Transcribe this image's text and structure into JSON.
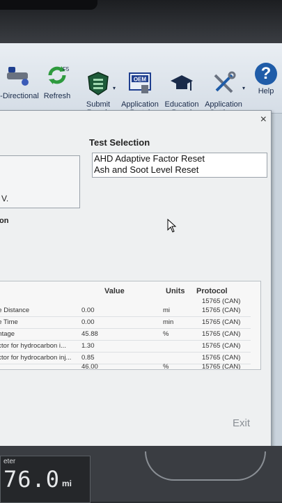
{
  "toolbar": {
    "items": [
      {
        "label": "-Directional",
        "icon": "directional-icon"
      },
      {
        "label": "Refresh",
        "key": "F5",
        "icon": "refresh-icon"
      },
      {
        "label": "Submit\nRepair",
        "icon": "submit-repair-icon"
      },
      {
        "label": "Application\nPortal",
        "icon": "oem-portal-icon",
        "badge": "OEM"
      },
      {
        "label": "Education\nPortal",
        "icon": "graduation-cap-icon"
      },
      {
        "label": "Application\nSettings",
        "icon": "tools-icon"
      },
      {
        "label": "Help",
        "icon": "help-icon",
        "glyph": "?"
      }
    ]
  },
  "dialog": {
    "close": "×",
    "left_panel_text": "V.",
    "section_label": "on",
    "test_selection": {
      "title": "Test Selection",
      "options": [
        "AHD Adaptive Factor Reset",
        "Ash and Soot Level Reset"
      ]
    },
    "grid": {
      "headers": {
        "value": "Value",
        "units": "Units",
        "protocol": "Protocol"
      },
      "rows": [
        {
          "name": "",
          "value": "",
          "unit": "",
          "protocol": "15765 (CAN)"
        },
        {
          "name": "ge Distance",
          "value": "0.00",
          "unit": "mi",
          "protocol": "15765 (CAN)"
        },
        {
          "name": "ge Time",
          "value": "0.00",
          "unit": "min",
          "protocol": "15765 (CAN)"
        },
        {
          "name": "entage",
          "value": "45.88",
          "unit": "%",
          "protocol": "15765 (CAN)"
        },
        {
          "name": "actor for hydrocarbon i...",
          "value": "1.30",
          "unit": "",
          "protocol": "15765 (CAN)"
        },
        {
          "name": "actor for hydrocarbon inj...",
          "value": "0.85",
          "unit": "",
          "protocol": "15765 (CAN)"
        },
        {
          "name": "",
          "value": "46.00",
          "unit": "%",
          "protocol": "15765 (CAN)"
        }
      ]
    },
    "exit_label": "Exit"
  },
  "status": {
    "odometer_label": "eter",
    "odometer_value": "76.0",
    "odometer_unit": "mi"
  }
}
